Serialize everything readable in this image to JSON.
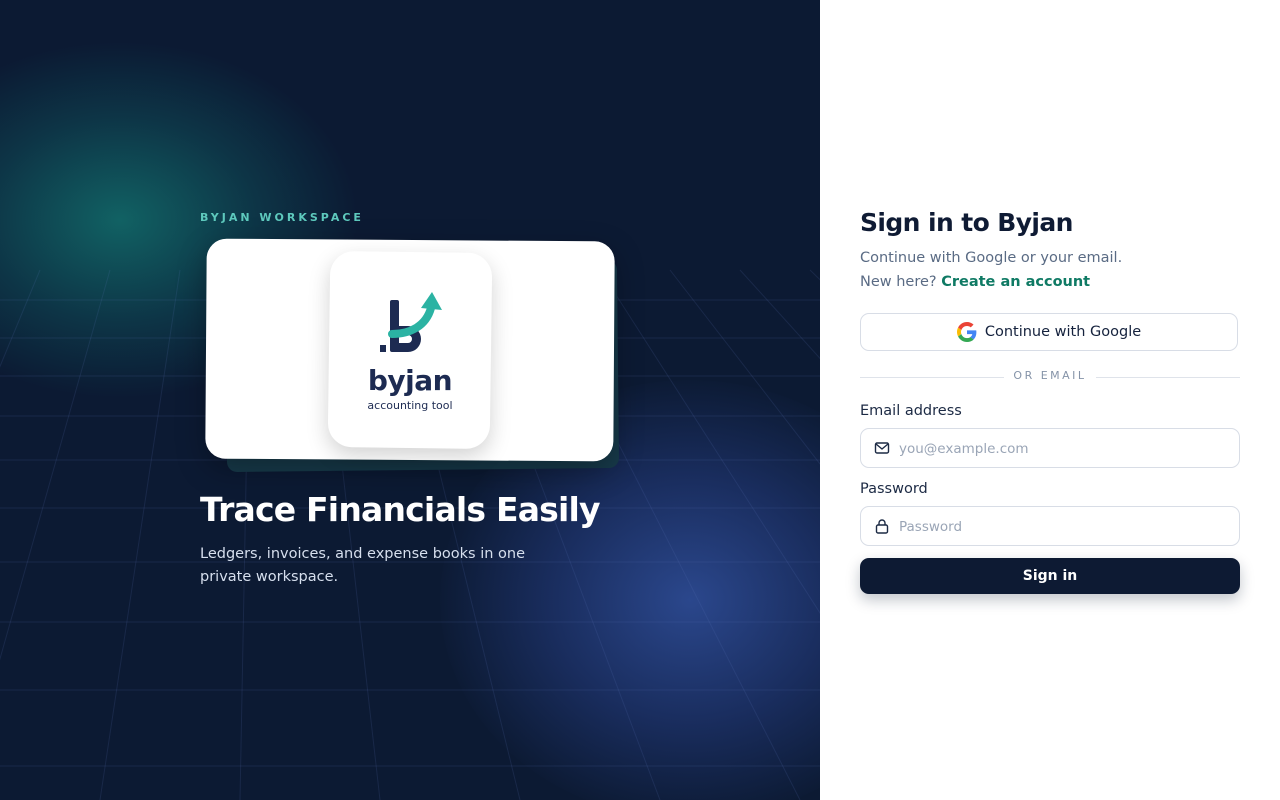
{
  "brand": {
    "eyebrow": "BYJAN WORKSPACE",
    "logo_word": "byjan",
    "logo_sub": "accounting tool",
    "hero_title": "Trace Financials Easily",
    "hero_desc": "Ledgers, invoices, and expense books in one private workspace."
  },
  "signin": {
    "title": "Sign in to Byjan",
    "subtitle": "Continue with Google or your email.",
    "new_here": "New here?",
    "create_account": "Create an account",
    "google_label": "Continue with Google",
    "divider": "OR EMAIL",
    "email_label": "Email address",
    "email_placeholder": "you@example.com",
    "email_value": "",
    "password_label": "Password",
    "password_placeholder": "Password",
    "password_value": "",
    "submit_label": "Sign in"
  },
  "icons": {
    "google": "google-icon",
    "email": "mail-icon",
    "password": "lock-icon",
    "logo": "byjan-logo-icon"
  },
  "colors": {
    "left_bg": "#0c1a33",
    "accent_teal": "#5ec9bd",
    "link": "#0f7a64",
    "primary_button": "#0d1a33",
    "logo_navy": "#1d2b52",
    "logo_teal": "#2bb3a3"
  }
}
